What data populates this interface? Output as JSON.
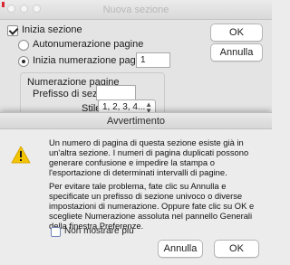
{
  "background_dialog": {
    "title": "Nuova sezione",
    "start_section_label": "Inizia sezione",
    "start_section_checked": true,
    "auto_numbering_label": "Autonumerazione pagine",
    "start_numbering_label": "Inizia numerazione pagine con:",
    "start_numbering_value": "1",
    "numbering_group_title": "Numerazione pagine",
    "section_prefix_label": "Prefisso di sezione:",
    "section_prefix_value": "",
    "style_label": "Stile:",
    "style_value": "1, 2, 3, 4...",
    "ok_label": "OK",
    "cancel_label": "Annulla"
  },
  "alert": {
    "title": "Avvertimento",
    "icon": "warning-triangle-icon",
    "message_1": "Un numero di pagina di questa sezione esiste già in un'altra sezione. I numeri di pagina duplicati possono generare confusione e impedire la stampa o l'esportazione di determinati intervalli di pagine.",
    "message_2": "Per evitare tale problema, fate clic su Annulla e specificate un prefisso di sezione univoco o diverse impostazioni di numerazione. Oppure fate clic su OK e scegliete Numerazione assoluta nel pannello Generali della finestra Preferenze.",
    "dont_show_label": "Non mostrare più",
    "dont_show_checked": false,
    "cancel_label": "Annulla",
    "ok_label": "OK"
  },
  "colors": {
    "warning_yellow": "#f4c400",
    "accent_red": "#d9282f"
  }
}
